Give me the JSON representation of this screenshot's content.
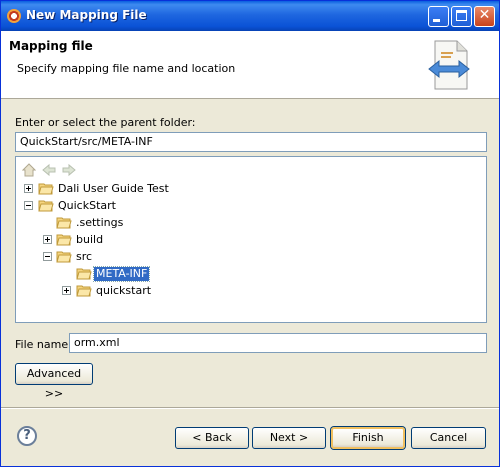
{
  "window": {
    "title": "New Mapping File",
    "controls": {
      "minimize": "minimize-icon",
      "maximize": "maximize-icon",
      "close": "✕"
    }
  },
  "banner": {
    "heading": "Mapping file",
    "description": "Specify mapping file name and location",
    "icon": "mapping-file-wizard-icon"
  },
  "folder_prompt": "Enter or select the parent folder:",
  "folder_path": "QuickStart/src/META-INF",
  "tree": {
    "nav_icons": [
      "home-icon",
      "back-icon",
      "forward-icon"
    ],
    "items": [
      {
        "label": "Dali User Guide Test",
        "expander": "plus"
      },
      {
        "label": "QuickStart",
        "expander": "minus"
      },
      {
        "label": ".settings",
        "expander": "none"
      },
      {
        "label": "build",
        "expander": "plus"
      },
      {
        "label": "src",
        "expander": "minus"
      },
      {
        "label": "META-INF",
        "expander": "none",
        "selected": true
      },
      {
        "label": "quickstart",
        "expander": "plus"
      }
    ]
  },
  "file_name": {
    "label": "File name:",
    "value": "orm.xml"
  },
  "advanced_label": "Advanced >>",
  "buttons": {
    "help": "?",
    "back": "< Back",
    "next": "Next >",
    "finish": "Finish",
    "cancel": "Cancel"
  },
  "colors": {
    "titlebar": "#0a52d6",
    "selection": "#316ac5",
    "dialog_bg": "#ece9d8"
  }
}
